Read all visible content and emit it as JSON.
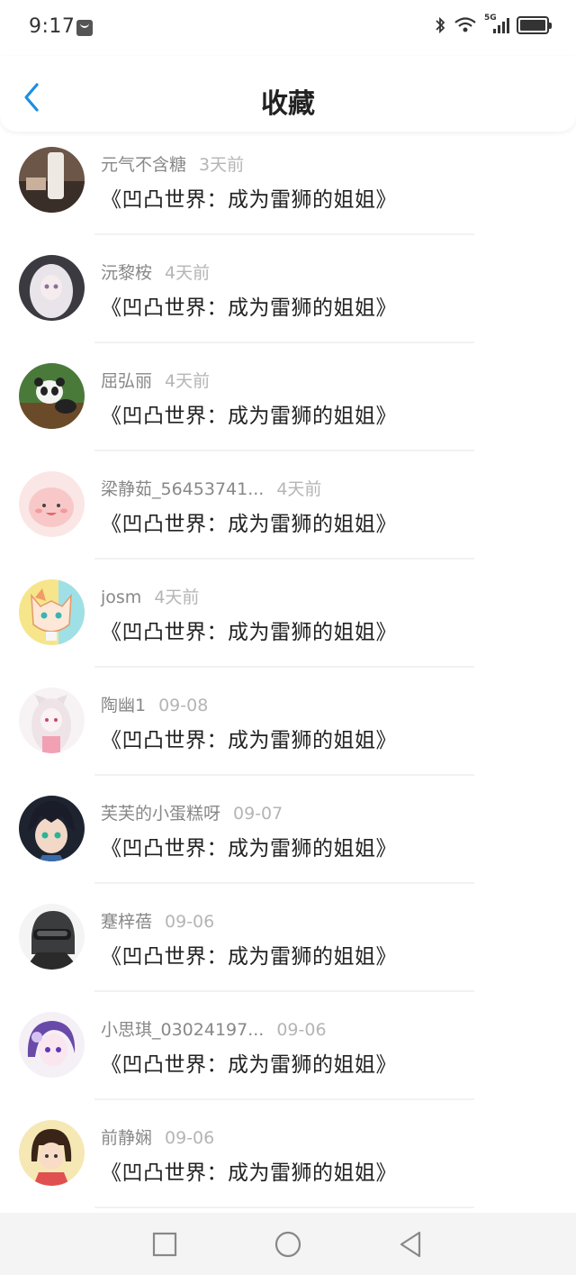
{
  "status_bar": {
    "time": "9:17",
    "network": "5G"
  },
  "header": {
    "title": "收藏"
  },
  "items": [
    {
      "user": "元气不含糖",
      "time": "3天前",
      "title": "《凹凸世界：成为雷狮的姐姐》"
    },
    {
      "user": "沅黎桉",
      "time": "4天前",
      "title": "《凹凸世界：成为雷狮的姐姐》"
    },
    {
      "user": "屈弘丽",
      "time": "4天前",
      "title": "《凹凸世界：成为雷狮的姐姐》"
    },
    {
      "user": "梁静茹_56453741...",
      "time": "4天前",
      "title": "《凹凸世界：成为雷狮的姐姐》"
    },
    {
      "user": "josm",
      "time": "4天前",
      "title": "《凹凸世界：成为雷狮的姐姐》"
    },
    {
      "user": "陶幽1",
      "time": "09-08",
      "title": "《凹凸世界：成为雷狮的姐姐》"
    },
    {
      "user": "芙芙的小蛋糕呀",
      "time": "09-07",
      "title": "《凹凸世界：成为雷狮的姐姐》"
    },
    {
      "user": "蹇梓蓓",
      "time": "09-06",
      "title": "《凹凸世界：成为雷狮的姐姐》"
    },
    {
      "user": "小思琪_03024197...",
      "time": "09-06",
      "title": "《凹凸世界：成为雷狮的姐姐》"
    },
    {
      "user": "前静娴",
      "time": "09-06",
      "title": "《凹凸世界：成为雷狮的姐姐》"
    }
  ],
  "colors": {
    "accent": "#1a8fe3",
    "username": "#888888",
    "timestamp": "#b5b5b5",
    "title": "#222222"
  },
  "nav_icons": [
    "recents-square-icon",
    "home-circle-icon",
    "back-triangle-icon"
  ]
}
